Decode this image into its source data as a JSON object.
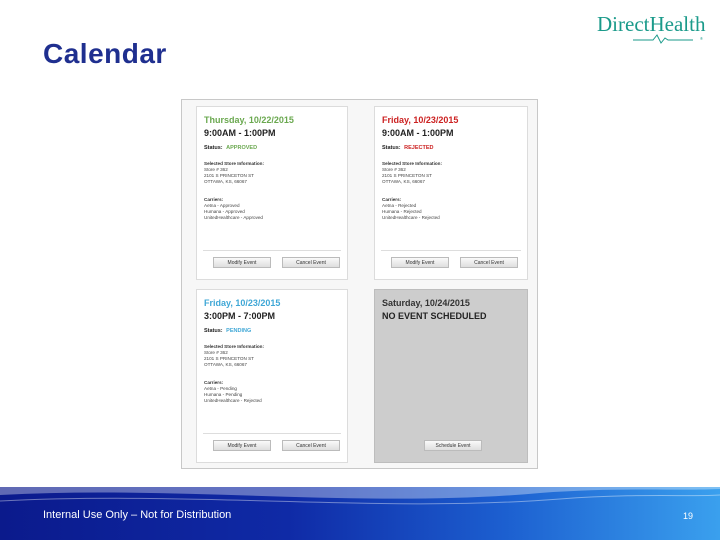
{
  "slide": {
    "title": "Calendar"
  },
  "logo": {
    "word1": "Direct",
    "word2": "Health",
    "tm": "®"
  },
  "cards": [
    {
      "date": "Thursday, 10/22/2015",
      "date_color": "#6aa84f",
      "time": "9:00AM - 1:00PM",
      "status_label": "Status:",
      "status_value": "APPROVED",
      "status_color": "#6aa84f",
      "store_header": "Selected Store Information:",
      "store_lines": [
        "Store # 362",
        "2101 S PRINCETON ST",
        "OTTAWA, KS, 66067"
      ],
      "carriers_header": "Carriers:",
      "carrier_lines": [
        "Aetna - Approved",
        "Humana - Approved",
        "UnitedHealthcare - Approved"
      ],
      "buttons": [
        "Modify Event",
        "Cancel Event"
      ]
    },
    {
      "date": "Friday, 10/23/2015",
      "date_color": "#cc2222",
      "time": "9:00AM - 1:00PM",
      "status_label": "Status:",
      "status_value": "REJECTED",
      "status_color": "#cc2222",
      "store_header": "Selected Store Information:",
      "store_lines": [
        "Store # 362",
        "2101 S PRINCETON ST",
        "OTTAWA, KS, 66067"
      ],
      "carriers_header": "Carriers:",
      "carrier_lines": [
        "Aetna - Rejected",
        "Humana - Rejected",
        "UnitedHealthcare - Rejected"
      ],
      "buttons": [
        "Modify Event",
        "Cancel Event"
      ]
    },
    {
      "date": "Friday, 10/23/2015",
      "date_color": "#3fa7d6",
      "time": "3:00PM - 7:00PM",
      "status_label": "Status:",
      "status_value": "PENDING",
      "status_color": "#3fa7d6",
      "store_header": "Selected Store Information:",
      "store_lines": [
        "Store # 362",
        "2101 S PRINCETON ST",
        "OTTAWA, KS, 66067"
      ],
      "carriers_header": "Carriers:",
      "carrier_lines": [
        "Aetna - Pending",
        "Humana - Pending",
        "UnitedHealthcare - Rejected"
      ],
      "buttons": [
        "Modify Event",
        "Cancel Event"
      ]
    },
    {
      "date": "Saturday, 10/24/2015",
      "date_color": "#333333",
      "time": "NO EVENT SCHEDULED",
      "buttons": [
        "Schedule Event"
      ]
    }
  ],
  "footer": {
    "text": "Internal Use Only – Not for Distribution",
    "page": "19"
  }
}
